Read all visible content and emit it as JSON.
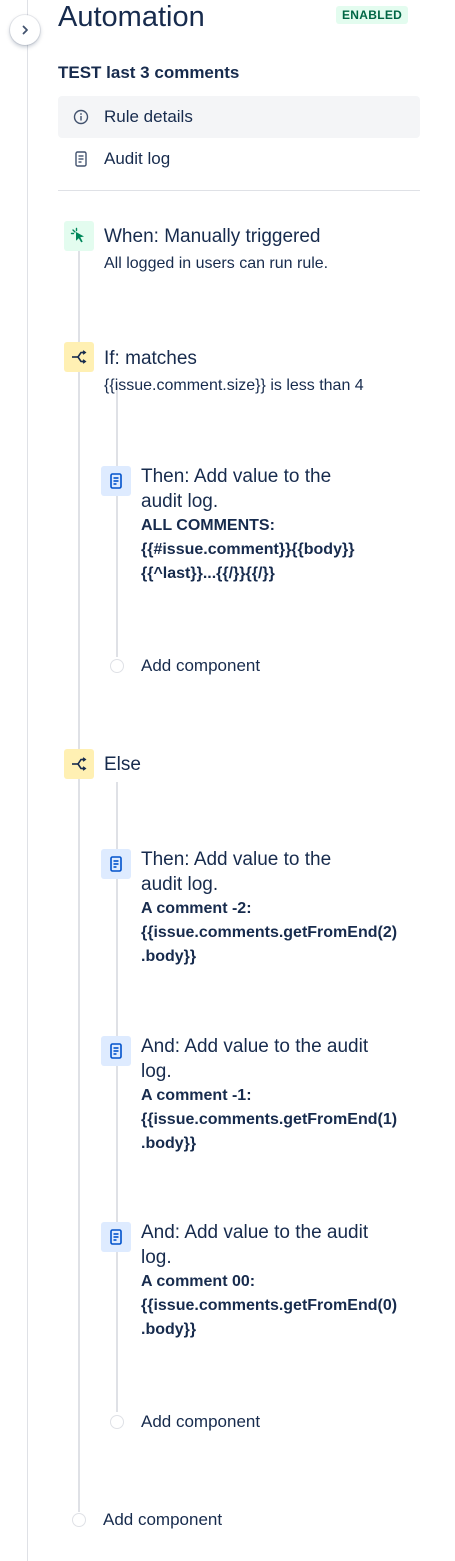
{
  "header": {
    "title": "Automation",
    "status_badge": "ENABLED",
    "rule_name": "TEST last 3 comments"
  },
  "nav": {
    "rule_details": "Rule details",
    "audit_log": "Audit log"
  },
  "trigger": {
    "title": "When: Manually triggered",
    "subtitle": "All logged in users can run rule."
  },
  "if_block": {
    "title": "If: matches",
    "subtitle": "{{issue.comment.size}} is less than 4",
    "actions": [
      {
        "title_line1": "Then: Add value to the",
        "title_line2": "audit log.",
        "lines": [
          "ALL COMMENTS:",
          "{{#issue.comment}}{{body}}",
          "{{^last}}...{{/}}{{/}}"
        ]
      }
    ],
    "add_component": "Add component"
  },
  "else_block": {
    "title": "Else",
    "actions": [
      {
        "title_line1": "Then: Add value to the",
        "title_line2": "audit log.",
        "lines": [
          "A comment -2:",
          "{{issue.comments.getFromEnd(2)",
          ".body}}"
        ]
      },
      {
        "title_line1": "And: Add value to the audit",
        "title_line2": "log.",
        "lines": [
          "A comment -1:",
          "{{issue.comments.getFromEnd(1)",
          ".body}}"
        ]
      },
      {
        "title_line1": "And: Add value to the audit",
        "title_line2": "log.",
        "lines": [
          "A comment 00:",
          "{{issue.comments.getFromEnd(0)",
          ".body}}"
        ]
      }
    ],
    "add_component": "Add component"
  },
  "root_add_component": "Add component",
  "colors": {
    "text": "#172b4d",
    "badge_bg": "#e3fcef",
    "badge_text": "#006644",
    "trigger_icon_bg": "#e3fcef",
    "condition_icon_bg": "#fff0b3",
    "action_icon_bg": "#deebff",
    "line": "#dfe1e6"
  },
  "icons": {
    "collapse": "chevron-right-icon",
    "rule_details": "info-icon",
    "audit_log": "document-icon",
    "trigger": "cursor-click-icon",
    "condition": "branch-icon",
    "action": "document-icon"
  }
}
